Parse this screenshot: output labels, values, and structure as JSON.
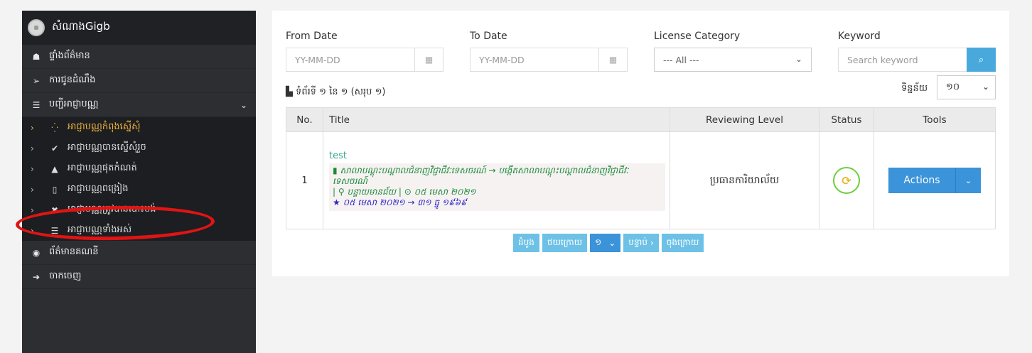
{
  "sidebar": {
    "title": "សំណាងGigb",
    "items": [
      {
        "icon": "dashboard-icon",
        "glyph": "☗",
        "label": "ផ្ទាំងព័ត៌មាន"
      },
      {
        "icon": "send-icon",
        "glyph": "➢",
        "label": "ការជូនដំណឹង"
      },
      {
        "icon": "list-icon",
        "glyph": "☰",
        "label": "បញ្ជីអាជ្ញាបណ្ណ"
      }
    ],
    "submenu": [
      {
        "icon": "spinner-icon",
        "glyph": "⁛",
        "label": "អាជ្ញាបណ្ណកំពុងស្នើសុំ",
        "active": true
      },
      {
        "icon": "check-icon",
        "glyph": "✔",
        "label": "អាជ្ញាបណ្ណបានស្នើសុំរួច"
      },
      {
        "icon": "warning-icon",
        "glyph": "▲",
        "label": "អាជ្ញាបណ្ណផុតកំណត់"
      },
      {
        "icon": "file-icon",
        "glyph": "▯",
        "label": "អាជ្ញាបណ្ណពង្រៀង"
      },
      {
        "icon": "close-icon",
        "glyph": "✖",
        "label": "អាជ្ញាបណ្ណត្រូវបានបោះបង់"
      },
      {
        "icon": "list-icon",
        "glyph": "☰",
        "label": "អាជ្ញាបណ្ណទាំងអស់"
      }
    ],
    "bottom": [
      {
        "icon": "user-icon",
        "glyph": "◉",
        "label": "ព័ត៌មានគណនី"
      },
      {
        "icon": "logout-icon",
        "glyph": "➔",
        "label": "ចាកចេញ"
      }
    ]
  },
  "filters": {
    "from_label": "From Date",
    "from_placeholder": "YY-MM-DD",
    "to_label": "To Date",
    "to_placeholder": "YY-MM-DD",
    "category_label": "License Category",
    "category_value": "--- All ---",
    "keyword_label": "Keyword",
    "keyword_placeholder": "Search keyword"
  },
  "pageinfo": "ទំព័រទី ១ នៃ ១ (សរុប ១)",
  "pagesize_label": "ទិន្នន័យ",
  "pagesize_value": "១០",
  "table": {
    "headers": [
      "No.",
      "Title",
      "Reviewing Level",
      "Status",
      "Tools"
    ],
    "row": {
      "no": "1",
      "title": "test",
      "line1": "សាលាបណ្ដុះបណ្ដាលជំនាញវិជ្ជាជីវៈទេសចរណ៍ → បង្កើតសាលាបណ្ដុះបណ្ដាលជំនាញវិជ្ជាជីវៈទេសចរណ៍",
      "location": "បន្ទាយមានជ័យ",
      "date": "០៥ មេសា ២០២១",
      "range": "០៥ មេសា ២០២១ → ៣១ ធ្នូ ១៩៦៩",
      "reviewing_level": "ប្រធានការិយាល័យ",
      "action_label": "Actions"
    }
  },
  "pager": {
    "first": "ដំបូង",
    "prev": "ថយក្រោយ",
    "page": "១",
    "next": "បន្ទាប់",
    "last": "ចុងក្រោយ"
  },
  "colors": {
    "sidebar_bg": "#2c2e31",
    "active": "#f0b43c",
    "primary": "#3b93d9",
    "highlight": "#e01414"
  }
}
